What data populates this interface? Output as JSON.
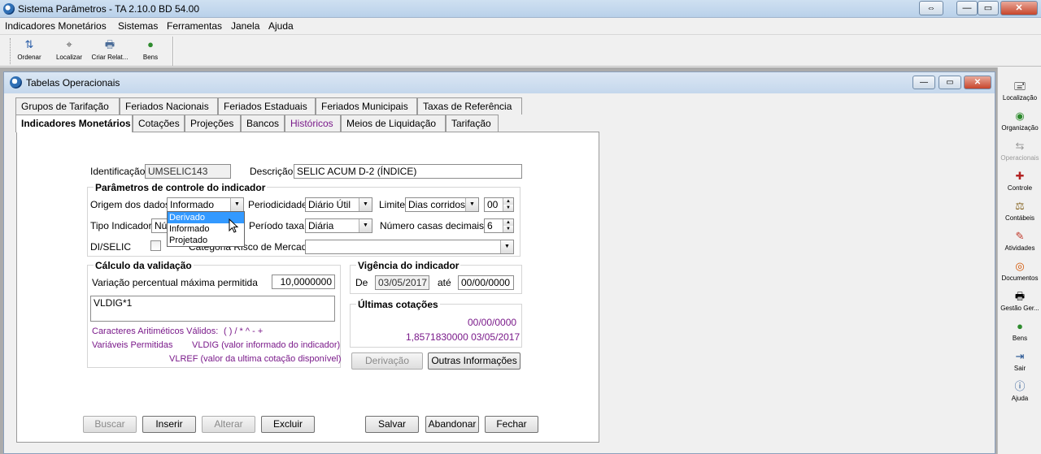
{
  "window": {
    "title": "Sistema Parâmetros -  TA 2.10.0 BD 54.00",
    "buttons": {
      "restore": "⇔",
      "minimize": "—",
      "maximize": "▭",
      "close": "✕"
    }
  },
  "menu": [
    "Indicadores Monetários",
    "Sistemas",
    "Ferramentas",
    "Janela",
    "Ajuda"
  ],
  "toolbar": [
    {
      "label": "Ordenar",
      "icon": "sort-icon"
    },
    {
      "label": "Localizar",
      "icon": "locate-icon"
    },
    {
      "label": "Criar Relat...",
      "icon": "printer-icon"
    },
    {
      "label": "Bens",
      "icon": "money-bag-icon"
    }
  ],
  "child": {
    "title": "Tabelas Operacionais"
  },
  "tabs_row1": [
    "Grupos de Tarifação",
    "Feriados Nacionais",
    "Feriados Estaduais",
    "Feriados Municipais",
    "Taxas de Referência"
  ],
  "tabs_row2": [
    "Indicadores Monetários",
    "Cotações",
    "Projeções",
    "Bancos",
    "Históricos",
    "Meios de Liquidação",
    "Tarifação"
  ],
  "form": {
    "identificacao_label": "Identificação",
    "identificacao": "UMSELIC143",
    "descricao_label": "Descrição",
    "descricao": "SELIC ACUM D-2 (ÍNDICE)",
    "params_title": "Parâmetros de controle do indicador",
    "origem_label": "Origem dos dados",
    "origem": "Informado",
    "origem_options": [
      "Derivado",
      "Informado",
      "Projetado"
    ],
    "periodicidade_label": "Periodicidade",
    "periodicidade": "Diário Útil",
    "limite_label": "Limite",
    "limite": "Dias corridos",
    "limite_num": "00",
    "tipo_label": "Tipo Indicador",
    "tipo_partial": "Nú",
    "periodo_label": "Período taxa",
    "periodo": "Diária",
    "casas_label": "Número casas decimais",
    "casas": "6",
    "diselic_label": "DI/SELIC",
    "categoria_label": "Categoria Risco de Mercado",
    "categoria": "",
    "calc_title": "Cálculo da validação",
    "variacao_label": "Variação percentual máxima permitida",
    "variacao": "10,0000000",
    "formula": "VLDIG*1",
    "carac_label": "Caracteres Aritiméticos Válidos:",
    "carac": "( ) / * ^ - +",
    "vars_label": "Variáveis Permitidas",
    "vldig": "VLDIG  (valor informado do indicador)",
    "vlref": "VLREF (valor da ultima cotação disponível)",
    "vigencia_title": "Vigência do indicador",
    "de_label": "De",
    "de": "03/05/2017",
    "ate_label": "até",
    "ate": "00/00/0000",
    "ultimas_title": "Últimas cotações",
    "cot1": "00/00/0000",
    "cot2": "1,8571830000  03/05/2017"
  },
  "buttons": {
    "derivacao": "Derivação",
    "outras": "Outras Informações",
    "buscar": "Buscar",
    "inserir": "Inserir",
    "alterar": "Alterar",
    "excluir": "Excluir",
    "salvar": "Salvar",
    "abandonar": "Abandonar",
    "fechar": "Fechar"
  },
  "side": [
    {
      "label": "Localização",
      "icon": "localizacao-icon"
    },
    {
      "label": "Organização",
      "icon": "organizacao-icon"
    },
    {
      "label": "Operacionais",
      "icon": "operacionais-icon"
    },
    {
      "label": "Controle",
      "icon": "controle-icon"
    },
    {
      "label": "Contábeis",
      "icon": "contabeis-icon"
    },
    {
      "label": "Atividades",
      "icon": "atividades-icon"
    },
    {
      "label": "Documentos",
      "icon": "documentos-icon"
    },
    {
      "label": "Gestão Ger...",
      "icon": "gestao-icon"
    },
    {
      "label": "Bens",
      "icon": "bens-icon"
    },
    {
      "label": "Sair",
      "icon": "sair-icon"
    },
    {
      "label": "Ajuda",
      "icon": "ajuda-icon"
    }
  ]
}
